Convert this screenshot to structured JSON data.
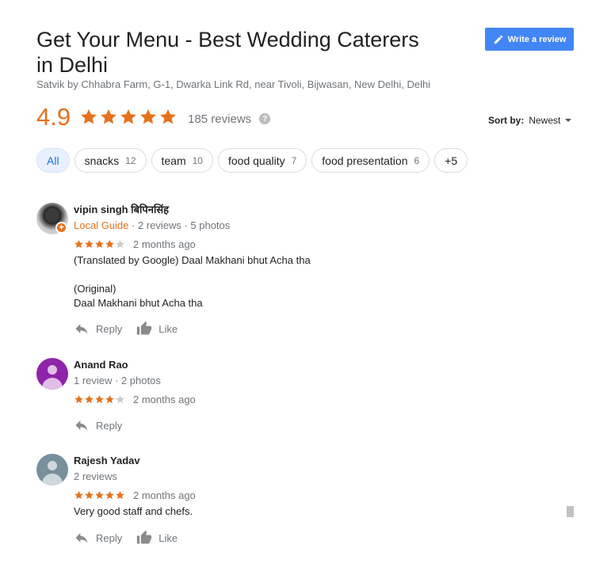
{
  "header": {
    "title": "Get Your Menu - Best Wedding Caterers in Delhi",
    "address": "Satvik by Chhabra Farm, G-1, Dwarka Link Rd, near Tivoli, Bijwasan, New Delhi, Delhi",
    "write_review_label": "Write a review"
  },
  "summary": {
    "rating": "4.9",
    "stars": 5,
    "review_count": "185 reviews",
    "help": "?"
  },
  "sort": {
    "label": "Sort by:",
    "value": "Newest"
  },
  "chips": [
    {
      "label": "All",
      "count": ""
    },
    {
      "label": "snacks",
      "count": "12"
    },
    {
      "label": "team",
      "count": "10"
    },
    {
      "label": "food quality",
      "count": "7"
    },
    {
      "label": "food presentation",
      "count": "6"
    },
    {
      "label": "+5",
      "count": ""
    }
  ],
  "reviews": [
    {
      "name": "vipin singh बिपिनसिंह",
      "guide": "Local Guide",
      "meta": " · 2 reviews · 5 photos",
      "stars": 4,
      "ago": "2 months ago",
      "text": [
        "(Translated by Google) Daal Makhani bhut Acha tha",
        "",
        "(Original)",
        "Daal Makhani bhut Acha tha"
      ],
      "reply": "Reply",
      "like": "Like"
    },
    {
      "name": "Anand Rao",
      "meta": "1 review · 2 photos",
      "stars": 4,
      "ago": "2 months ago",
      "reply": "Reply"
    },
    {
      "name": "Rajesh Yadav",
      "meta": "2 reviews",
      "stars": 5,
      "ago": "2 months ago",
      "text": [
        "Very good staff and chefs."
      ],
      "reply": "Reply",
      "like": "Like"
    }
  ],
  "colors": {
    "accent_orange": "#e7711b",
    "button_blue": "#4285f4",
    "chip_active_bg": "#e8f0fe"
  },
  "icons": {
    "pencil": "pencil-icon",
    "star": "star-icon",
    "reply": "reply-arrow-icon",
    "like": "thumbs-up-icon",
    "help": "help-icon"
  }
}
